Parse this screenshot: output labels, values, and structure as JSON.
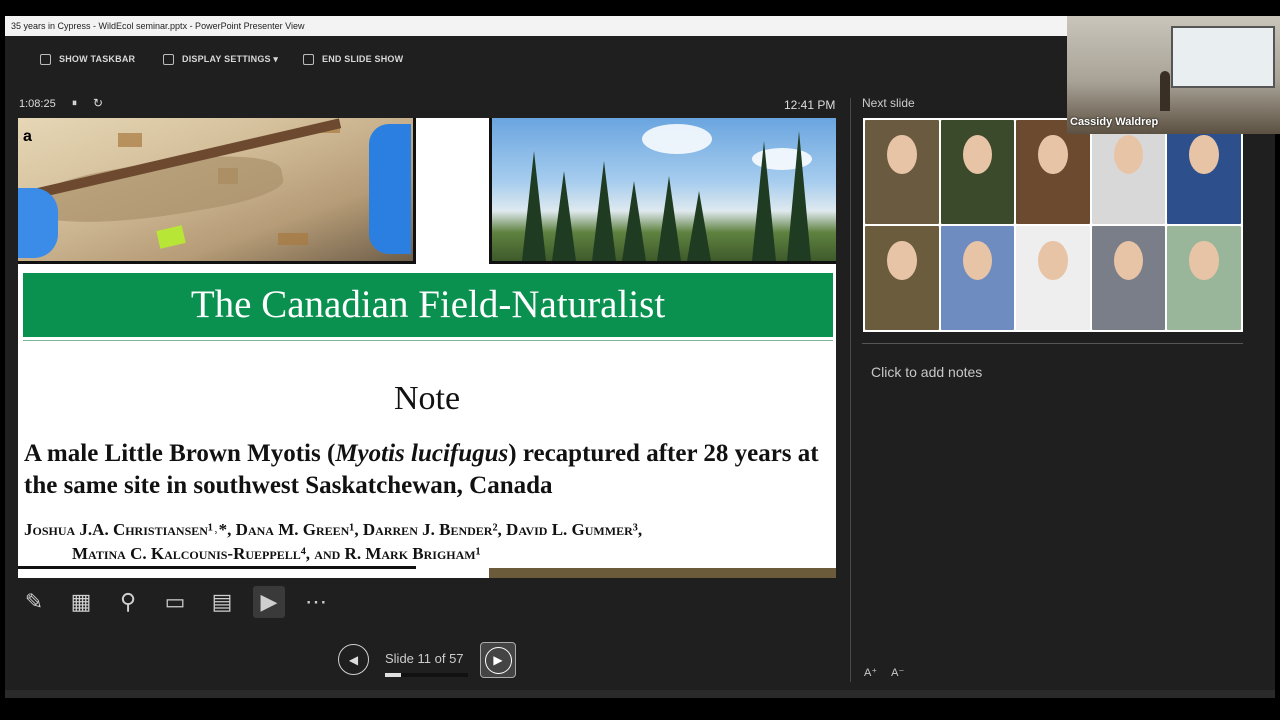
{
  "window": {
    "title": "35 years in Cypress - WildEcol seminar.pptx - PowerPoint Presenter View"
  },
  "toolbar": {
    "show_taskbar": "SHOW TASKBAR",
    "display_settings": "DISPLAY SETTINGS ▾",
    "end_slide_show": "END SLIDE SHOW"
  },
  "timer": {
    "elapsed": "1:08:25",
    "pause_icon": "⏸",
    "reset_icon": "↻",
    "clock": "12:41 PM"
  },
  "slide": {
    "panel_label": "a",
    "journal": "The Canadian Field-Naturalist",
    "section": "Note",
    "title_before": "A male Little Brown Myotis (",
    "title_italic": "Myotis lucifugus",
    "title_after": ") recaptured after 28 years at the same site in southwest Saskatchewan, Canada",
    "authors_line1": "Joshua J.A. Christiansen¹˒*, Dana M. Green¹, Darren J. Bender², David L. Gummer³,",
    "authors_line2": "Matina C. Kalcounis-Rueppell⁴, and R. Mark Brigham¹"
  },
  "nav": {
    "prev_icon": "◀",
    "next_icon": "▶",
    "counter": "Slide 11 of 57",
    "current": 11,
    "total": 57
  },
  "next_slide": {
    "label": "Next slide"
  },
  "notes": {
    "placeholder": "Click to add notes"
  },
  "webcam": {
    "name": "Cassidy Waldrep"
  },
  "font_controls": {
    "increase": "A⁺",
    "decrease": "A⁻"
  },
  "colors": {
    "journal_green": "#0a9150",
    "panel_bg": "#1f1f1f"
  }
}
